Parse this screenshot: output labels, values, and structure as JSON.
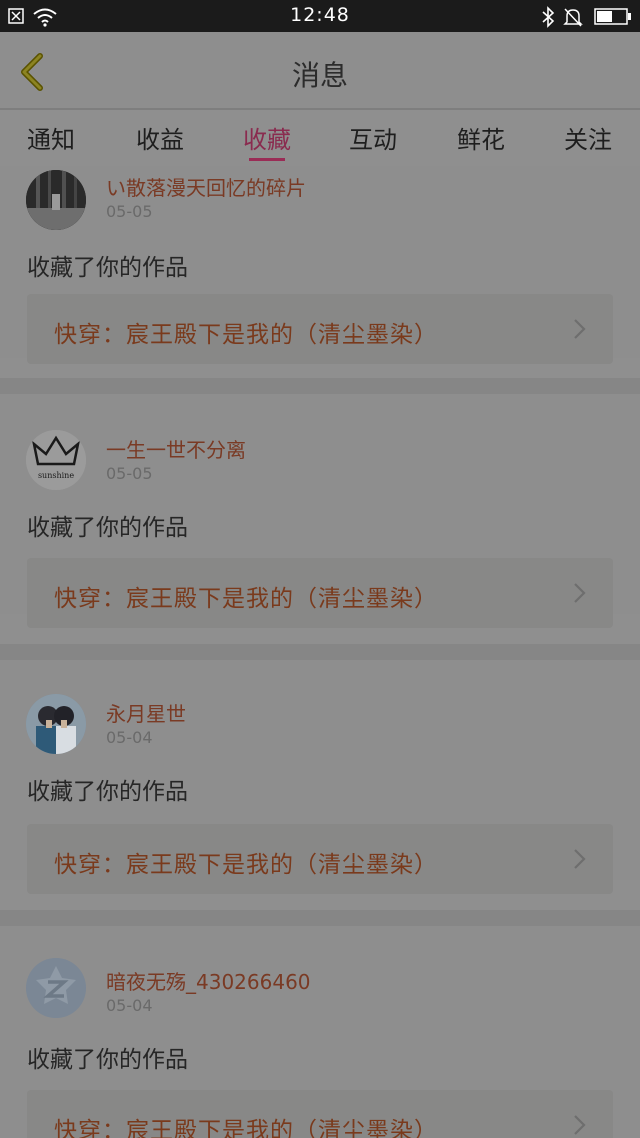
{
  "status_bar": {
    "time": "12:48"
  },
  "header": {
    "title": "消息"
  },
  "tabs": [
    {
      "label": "通知",
      "active": false
    },
    {
      "label": "收益",
      "active": false
    },
    {
      "label": "收藏",
      "active": true
    },
    {
      "label": "互动",
      "active": false
    },
    {
      "label": "鲜花",
      "active": false
    },
    {
      "label": "关注",
      "active": false
    }
  ],
  "messages": [
    {
      "user": "い散落漫天回忆的碎片",
      "date": "05-05",
      "action": "收藏了你的作品",
      "work": "快穿：宸王殿下是我的（清尘墨染）"
    },
    {
      "user": "一生一世不分离",
      "date": "05-05",
      "action": "收藏了你的作品",
      "work": "快穿：宸王殿下是我的（清尘墨染）",
      "avatar_text": "sunshine"
    },
    {
      "user": "永月星世",
      "date": "05-04",
      "action": "收藏了你的作品",
      "work": "快穿：宸王殿下是我的（清尘墨染）"
    },
    {
      "user": "暗夜无殇_430266460",
      "date": "05-04",
      "action": "收藏了你的作品",
      "work": "快穿：宸王殿下是我的（清尘墨染）"
    }
  ],
  "colors": {
    "accent": "#9a2c56",
    "work_title": "#7a3a1c",
    "overlay_bg": "#8f8f8f"
  },
  "icons": [
    "close-box-icon",
    "wifi-icon",
    "bluetooth-icon",
    "bell-muted-icon",
    "battery-icon",
    "back-chevron-icon",
    "chevron-right-icon"
  ]
}
